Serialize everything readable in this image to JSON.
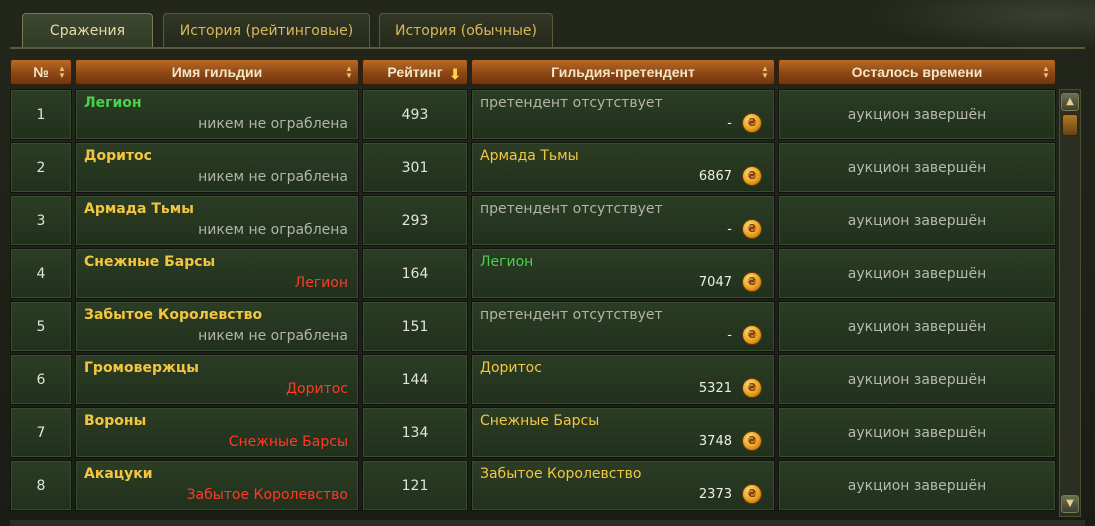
{
  "tabs": [
    {
      "label": "Сражения",
      "active": true
    },
    {
      "label": "История (рейтинговые)",
      "active": false
    },
    {
      "label": "История (обычные)",
      "active": false
    }
  ],
  "columns": {
    "num": "№",
    "guild": "Имя гильдии",
    "rating": "Рейтинг",
    "challenger": "Гильдия-претендент",
    "time_left": "Осталось времени"
  },
  "rows": [
    {
      "num": "1",
      "guild": "Легион",
      "guild_color": "green",
      "sub": "никем не ограблена",
      "sub_color": "gray",
      "rating": "493",
      "challenger": "претендент отсутствует",
      "challenger_color": "gray",
      "bid": "-",
      "time": "аукцион завершён"
    },
    {
      "num": "2",
      "guild": "Доритос",
      "guild_color": "gold",
      "sub": "никем не ограблена",
      "sub_color": "gray",
      "rating": "301",
      "challenger": "Армада Тьмы",
      "challenger_color": "gold",
      "bid": "6867",
      "time": "аукцион завершён"
    },
    {
      "num": "3",
      "guild": "Армада Тьмы",
      "guild_color": "gold",
      "sub": "никем не ограблена",
      "sub_color": "gray",
      "rating": "293",
      "challenger": "претендент отсутствует",
      "challenger_color": "gray",
      "bid": "-",
      "time": "аукцион завершён"
    },
    {
      "num": "4",
      "guild": "Снежные Барсы",
      "guild_color": "gold",
      "sub": "Легион",
      "sub_color": "red",
      "rating": "164",
      "challenger": "Легион",
      "challenger_color": "green",
      "bid": "7047",
      "time": "аукцион завершён"
    },
    {
      "num": "5",
      "guild": "Забытое Королевство",
      "guild_color": "gold",
      "sub": "никем не ограблена",
      "sub_color": "gray",
      "rating": "151",
      "challenger": "претендент отсутствует",
      "challenger_color": "gray",
      "bid": "-",
      "time": "аукцион завершён"
    },
    {
      "num": "6",
      "guild": "Громовержцы",
      "guild_color": "gold",
      "sub": "Доритос",
      "sub_color": "red",
      "rating": "144",
      "challenger": "Доритос",
      "challenger_color": "gold",
      "bid": "5321",
      "time": "аукцион завершён"
    },
    {
      "num": "7",
      "guild": "Вороны",
      "guild_color": "gold",
      "sub": "Снежные Барсы",
      "sub_color": "red",
      "rating": "134",
      "challenger": "Снежные Барсы",
      "challenger_color": "gold",
      "bid": "3748",
      "time": "аукцион завершён"
    },
    {
      "num": "8",
      "guild": "Акацуки",
      "guild_color": "gold",
      "sub": "Забытое Королевство",
      "sub_color": "red",
      "rating": "121",
      "challenger": "Забытое Королевство",
      "challenger_color": "gold",
      "bid": "2373",
      "time": "аукцион завершён"
    }
  ],
  "colors": {
    "green": "#4ad24a",
    "gold": "#f4c640",
    "gray": "#b3b4a6",
    "red": "#ff3a28",
    "header": "#9a521a"
  },
  "icons": {
    "sort": "sort-arrows-icon",
    "sort_active": "sort-down-arrow-icon",
    "coin": "gold-coin-icon",
    "scroll_up": "scroll-up-icon",
    "scroll_down": "scroll-down-icon"
  }
}
